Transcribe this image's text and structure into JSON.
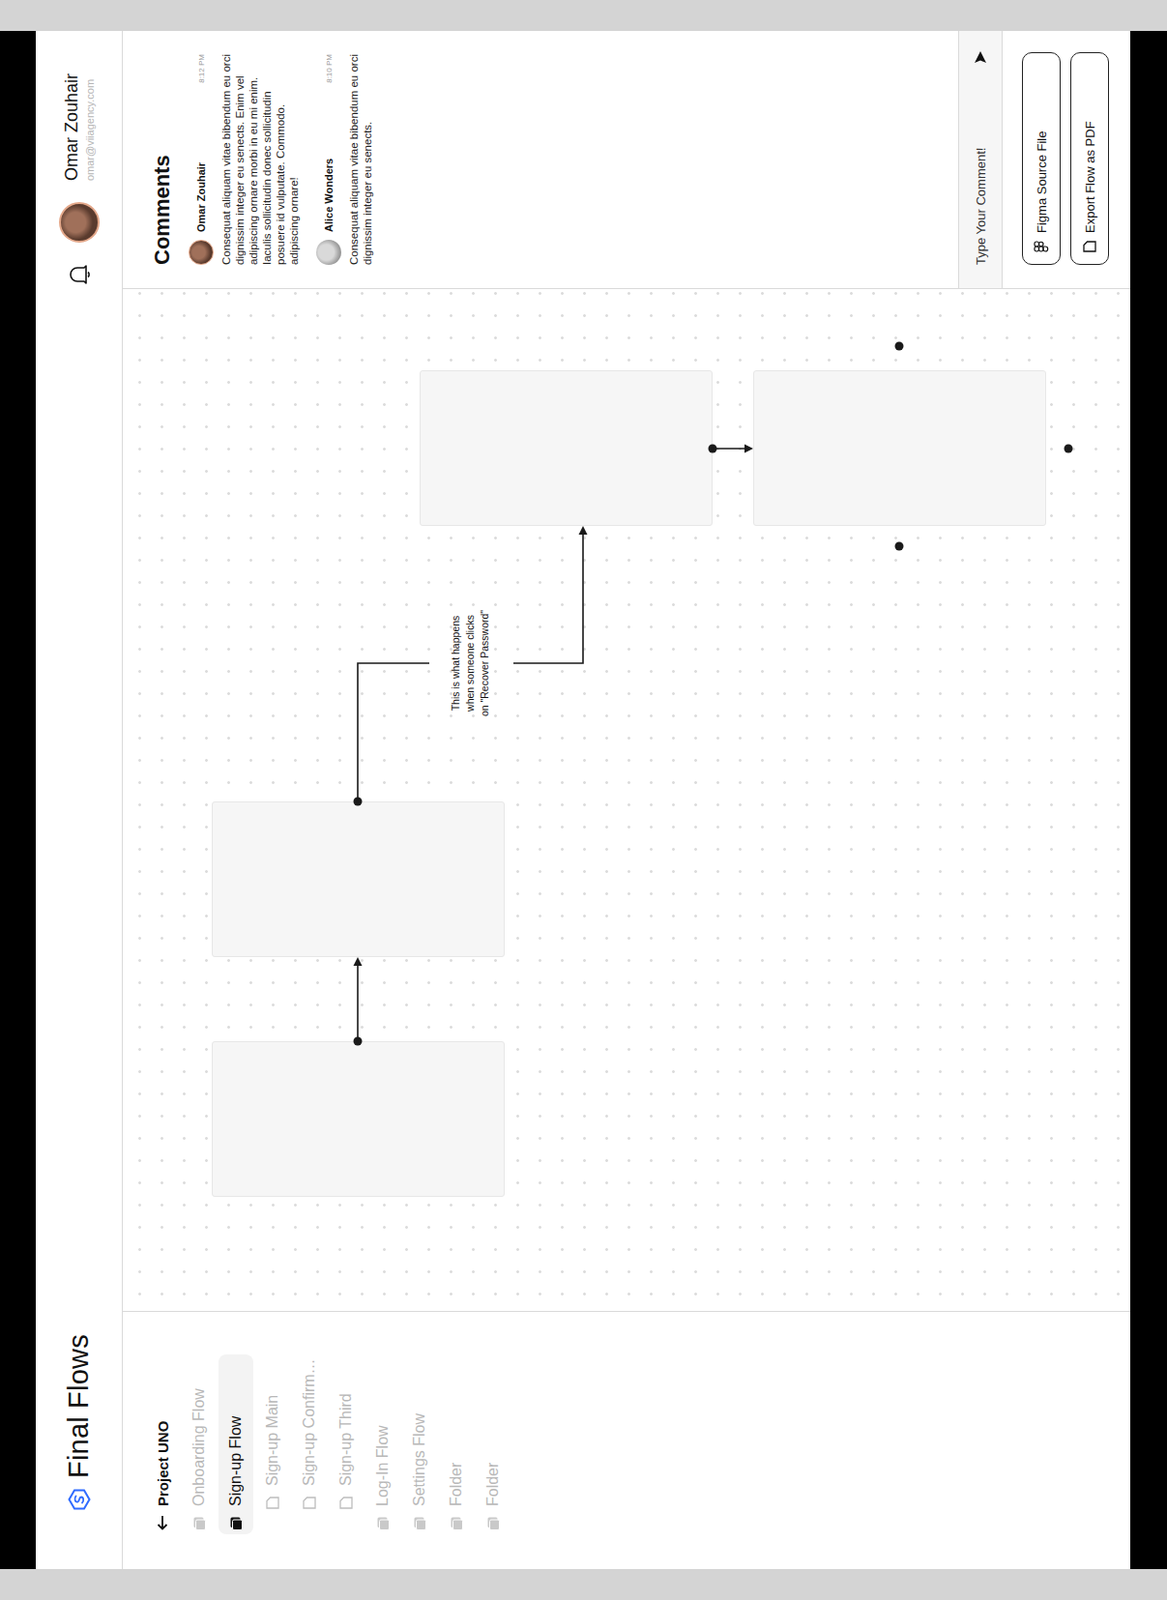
{
  "app": {
    "title": "Final Flows"
  },
  "user": {
    "name": "Omar Zouhair",
    "email": "omar@viiagency.com"
  },
  "sidebar": {
    "project": "Project UNO",
    "items": [
      {
        "label": "Onboarding Flow",
        "kind": "folder",
        "selected": false
      },
      {
        "label": "Sign-up Flow",
        "kind": "folder",
        "selected": true
      },
      {
        "label": "Sign-up Main",
        "kind": "file",
        "selected": false
      },
      {
        "label": "Sign-up Confirm…",
        "kind": "file",
        "selected": false
      },
      {
        "label": "Sign-up Third",
        "kind": "file",
        "selected": false
      },
      {
        "label": "Log-In Flow",
        "kind": "folder",
        "selected": false
      },
      {
        "label": "Settings Flow",
        "kind": "folder",
        "selected": false
      },
      {
        "label": "Folder",
        "kind": "folder",
        "selected": false
      },
      {
        "label": "Folder",
        "kind": "folder",
        "selected": false
      }
    ]
  },
  "canvas": {
    "note": [
      "This is what happens",
      "when someone clicks",
      "on \"Recover Password\""
    ]
  },
  "comments": {
    "title": "Comments",
    "items": [
      {
        "author": "Omar Zouhair",
        "time": "8:12 PM",
        "text": "Consequat aliquam vitae bibendum eu orci dignissim integer eu senects. Enim vel adipiscing ornare morbi in eu mi enim. Iaculis sollicitudin donec sollicitudin posuere id vulputate. Commodo. adipiscing ornare!"
      },
      {
        "author": "Alice Wonders",
        "time": "8:10 PM",
        "text": "Consequat aliquam vitae bibendum eu orci dignissim integer eu senects."
      }
    ],
    "input": {
      "placeholder": "Type Your Comment!"
    },
    "buttons": [
      "Figma Source File",
      "Export Flow as PDF"
    ]
  }
}
